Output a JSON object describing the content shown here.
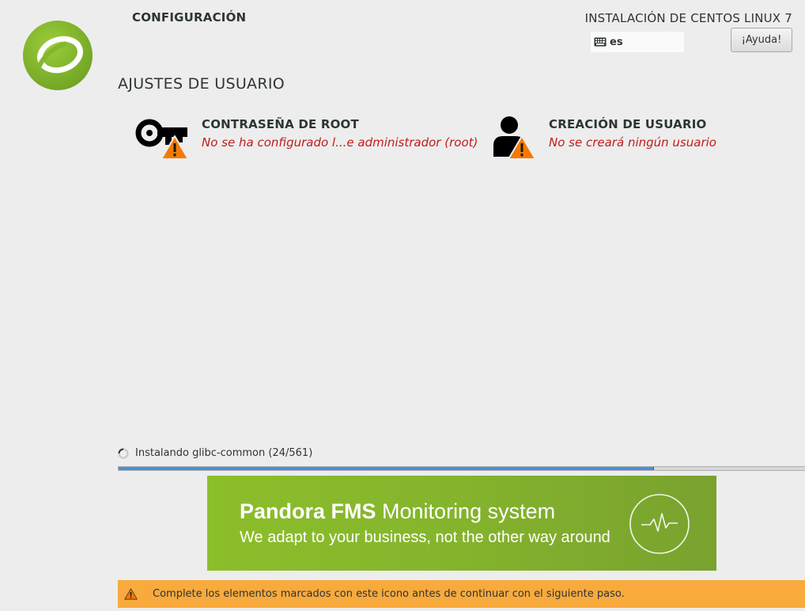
{
  "header": {
    "spoke_title": "CONFIGURACIÓN",
    "product_title": "INSTALACIÓN DE CENTOS LINUX 7",
    "keyboard_layout": "es",
    "help_label": "¡Ayuda!"
  },
  "section": {
    "title": "AJUSTES DE USUARIO"
  },
  "spokes": [
    {
      "name": "CONTRASEÑA DE ROOT",
      "status": "No se ha configurado l...e administrador (root)",
      "icon": "root-password-warning-icon"
    },
    {
      "name": "CREACIÓN DE USUARIO",
      "status": "No se creará ningún usuario",
      "icon": "user-creation-warning-icon"
    }
  ],
  "progress": {
    "text": "Instalando glibc-common (24/561)",
    "fraction": 0.78
  },
  "banner": {
    "title_bold": "Pandora FMS",
    "title_rest": " Monitoring system",
    "subtitle": "We adapt to your business, not the other way around"
  },
  "warning": {
    "text": "Complete los elementos marcados con este icono antes de continuar con el siguiente paso."
  },
  "colors": {
    "background": "#ededed",
    "status_error": "#c01c1c",
    "progress_fill": "#4a90d9",
    "warning_bar": "#f8aa3d",
    "banner_green": "#85b52c",
    "logo_green": "#82b92c"
  }
}
